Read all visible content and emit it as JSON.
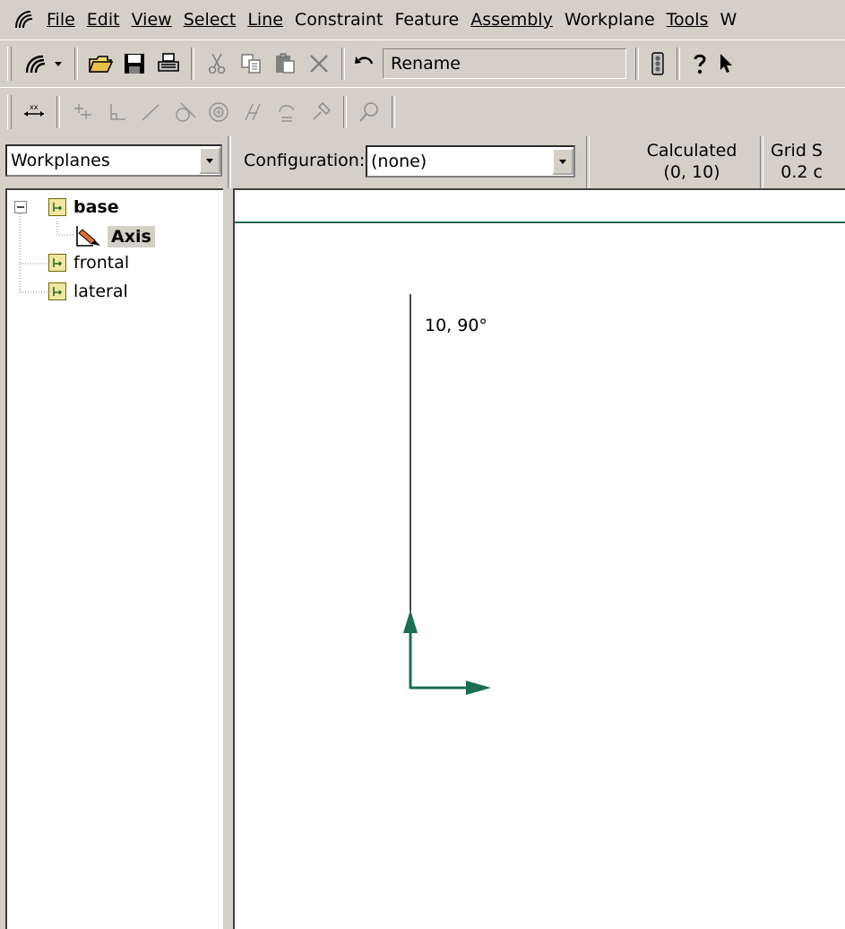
{
  "menubar": {
    "items": [
      "File",
      "Edit",
      "View",
      "Select",
      "Line",
      "Constraint",
      "Feature",
      "Assembly",
      "Workplane",
      "Tools",
      "W"
    ],
    "mnemonics": [
      0,
      0,
      0,
      0,
      0,
      10,
      6,
      0,
      4,
      0,
      0
    ]
  },
  "toolbar1": {
    "rename_label": "Rename"
  },
  "statusbar": {
    "workplanes_select": "Workplanes",
    "configuration_label": "Configuration:",
    "configuration_value": "(none)",
    "calculated_label": "Calculated",
    "calculated_value": "(0, 10)",
    "grid_label": "Grid S",
    "grid_value": "0.2 c"
  },
  "tree": {
    "nodes": [
      {
        "label": "base",
        "bold": true
      },
      {
        "label": "Axis",
        "bold": true,
        "selected": true
      },
      {
        "label": "frontal",
        "bold": false
      },
      {
        "label": "lateral",
        "bold": false
      }
    ]
  },
  "canvas": {
    "dimension_label": "10, 90°",
    "axis_color": "#1b6e52"
  }
}
